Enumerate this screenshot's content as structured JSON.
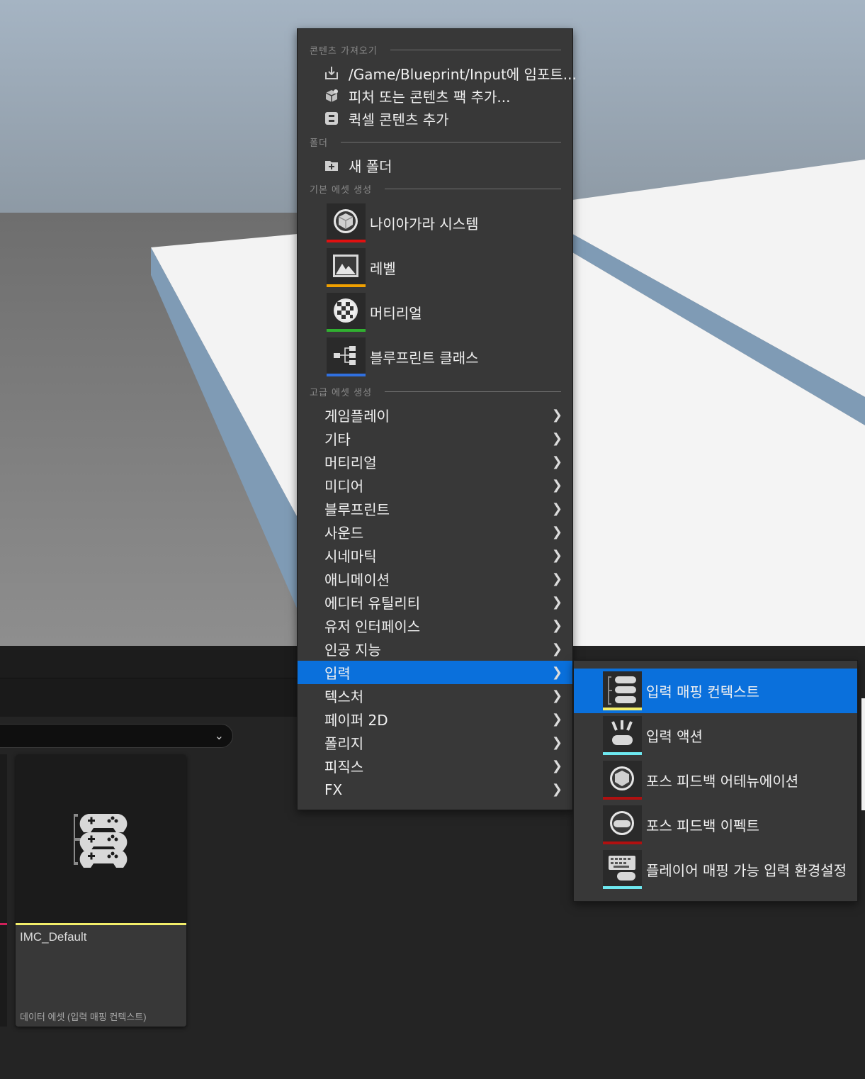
{
  "menu": {
    "sections": {
      "import": "콘텐츠 가져오기",
      "folder": "폴더",
      "basic": "기본 에셋 생성",
      "advanced": "고급 에셋 생성"
    },
    "import_items": [
      {
        "label": "/Game/Blueprint/Input에 임포트...",
        "icon": "import-icon"
      },
      {
        "label": "피처 또는 콘텐츠 팩 추가...",
        "icon": "content-pack-icon"
      },
      {
        "label": "퀵셀 콘텐츠 추가",
        "icon": "quixel-icon"
      }
    ],
    "folder_items": [
      {
        "label": "새 폴더",
        "icon": "new-folder-icon"
      }
    ],
    "basic_assets": [
      {
        "label": "나이아가라 시스템",
        "icon": "niagara-icon",
        "color": "#e01010"
      },
      {
        "label": "레벨",
        "icon": "level-icon",
        "color": "#f0a000"
      },
      {
        "label": "머티리얼",
        "icon": "material-icon",
        "color": "#30b030"
      },
      {
        "label": "블루프린트 클래스",
        "icon": "blueprint-icon",
        "color": "#3070e0"
      }
    ],
    "advanced_categories": [
      "게임플레이",
      "기타",
      "머티리얼",
      "미디어",
      "블루프린트",
      "사운드",
      "시네마틱",
      "애니메이션",
      "에디터 유틸리티",
      "유저 인터페이스",
      "인공 지능",
      "입력",
      "텍스처",
      "페이퍼 2D",
      "폴리지",
      "피직스",
      "FX"
    ],
    "highlighted_category": "입력"
  },
  "submenu": {
    "items": [
      {
        "label": "입력 매핑 컨텍스트",
        "icon": "input-mapping-context-icon",
        "color": "#f3ee6a"
      },
      {
        "label": "입력 액션",
        "icon": "input-action-icon",
        "color": "#6ee8f0"
      },
      {
        "label": "포스 피드백 어테뉴에이션",
        "icon": "force-feedback-attenuation-icon",
        "color": "#b01010"
      },
      {
        "label": "포스 피드백 이펙트",
        "icon": "force-feedback-effect-icon",
        "color": "#b01010"
      },
      {
        "label": "플레이어 매핑 가능 입력 환경설정",
        "icon": "player-mappable-input-icon",
        "color": "#6ee8f0"
      }
    ],
    "highlighted_index": 0
  },
  "asset_card": {
    "name": "IMC_Default",
    "type": "데이터 에셋 (입력 매핑 컨텍스트)",
    "icon": "input-mapping-context-icon",
    "color": "#f3ee6a"
  },
  "colors": {
    "highlight": "#0a70dc",
    "menu_bg": "#383838"
  }
}
